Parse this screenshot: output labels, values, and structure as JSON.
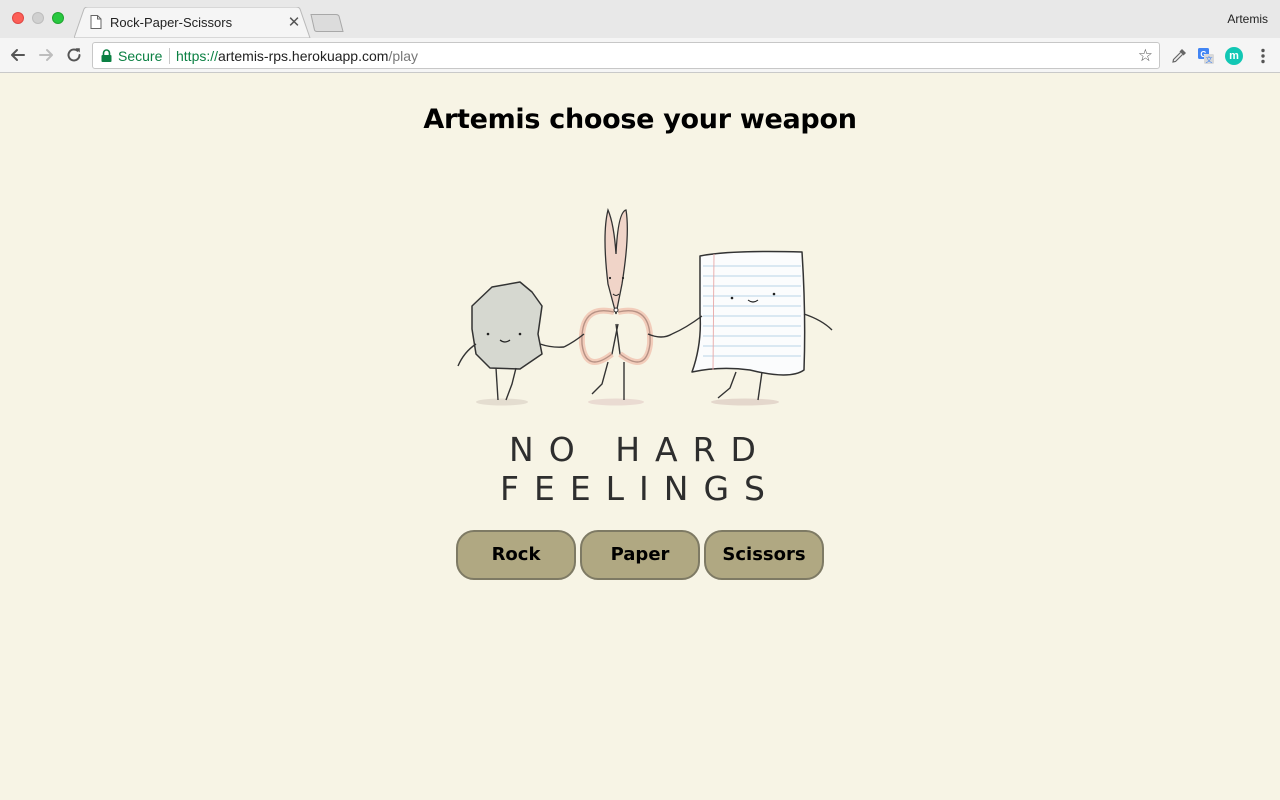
{
  "browser": {
    "tab_title": "Rock-Paper-Scissors",
    "profile_name": "Artemis",
    "secure_label": "Secure",
    "url": {
      "scheme": "https://",
      "host": "artemis-rps.herokuapp.com",
      "path": "/play"
    },
    "extension_m_letter": "m",
    "icons": [
      "document-icon",
      "close-icon",
      "back-icon",
      "forward-icon",
      "reload-icon",
      "lock-icon",
      "star-icon",
      "eyedropper-icon",
      "translate-icon",
      "menu-icon"
    ]
  },
  "page": {
    "heading": "Artemis choose your weapon",
    "illustration_tagline": "NO HARD FEELINGS",
    "buttons": {
      "rock": "Rock",
      "paper": "Paper",
      "scissors": "Scissors"
    },
    "colors": {
      "background": "#f7f4e5",
      "button": "#b0a882",
      "button_border": "#7e7a64"
    }
  }
}
